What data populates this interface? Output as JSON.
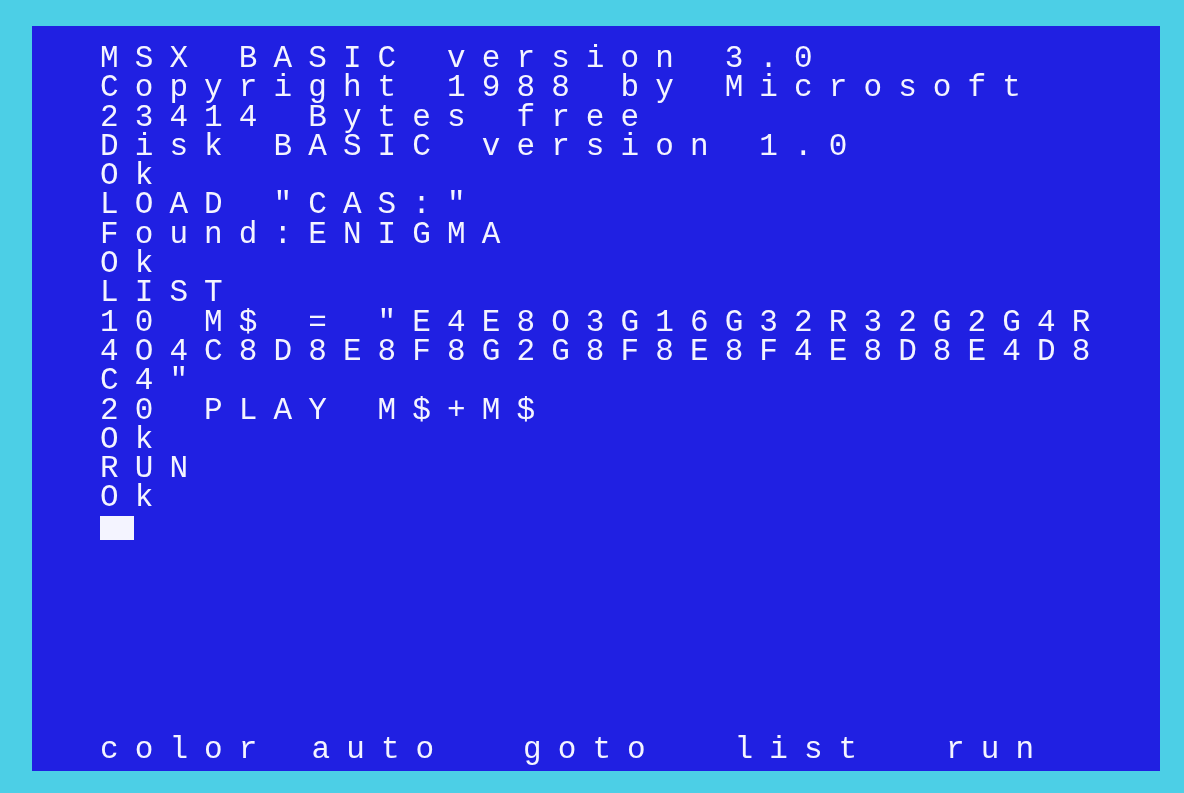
{
  "screen": {
    "lines": [
      "MSX BASIC version 3.0",
      "Copyright 1988 by Microsoft",
      "23414 Bytes free",
      "Disk BASIC version 1.0",
      "Ok",
      "LOAD \"CAS:\"",
      "Found:ENIGMA",
      "Ok",
      "LIST",
      "10 M$ = \"E4E8O3G16G32R32G2G4R",
      "4O4C8D8E8F8G2G8F8E8F4E8D8E4D8",
      "C4\"",
      "20 PLAY M$+M$",
      "Ok",
      "RUN",
      "Ok"
    ],
    "function_keys": [
      "color",
      "auto",
      "goto",
      "list",
      "run"
    ]
  }
}
